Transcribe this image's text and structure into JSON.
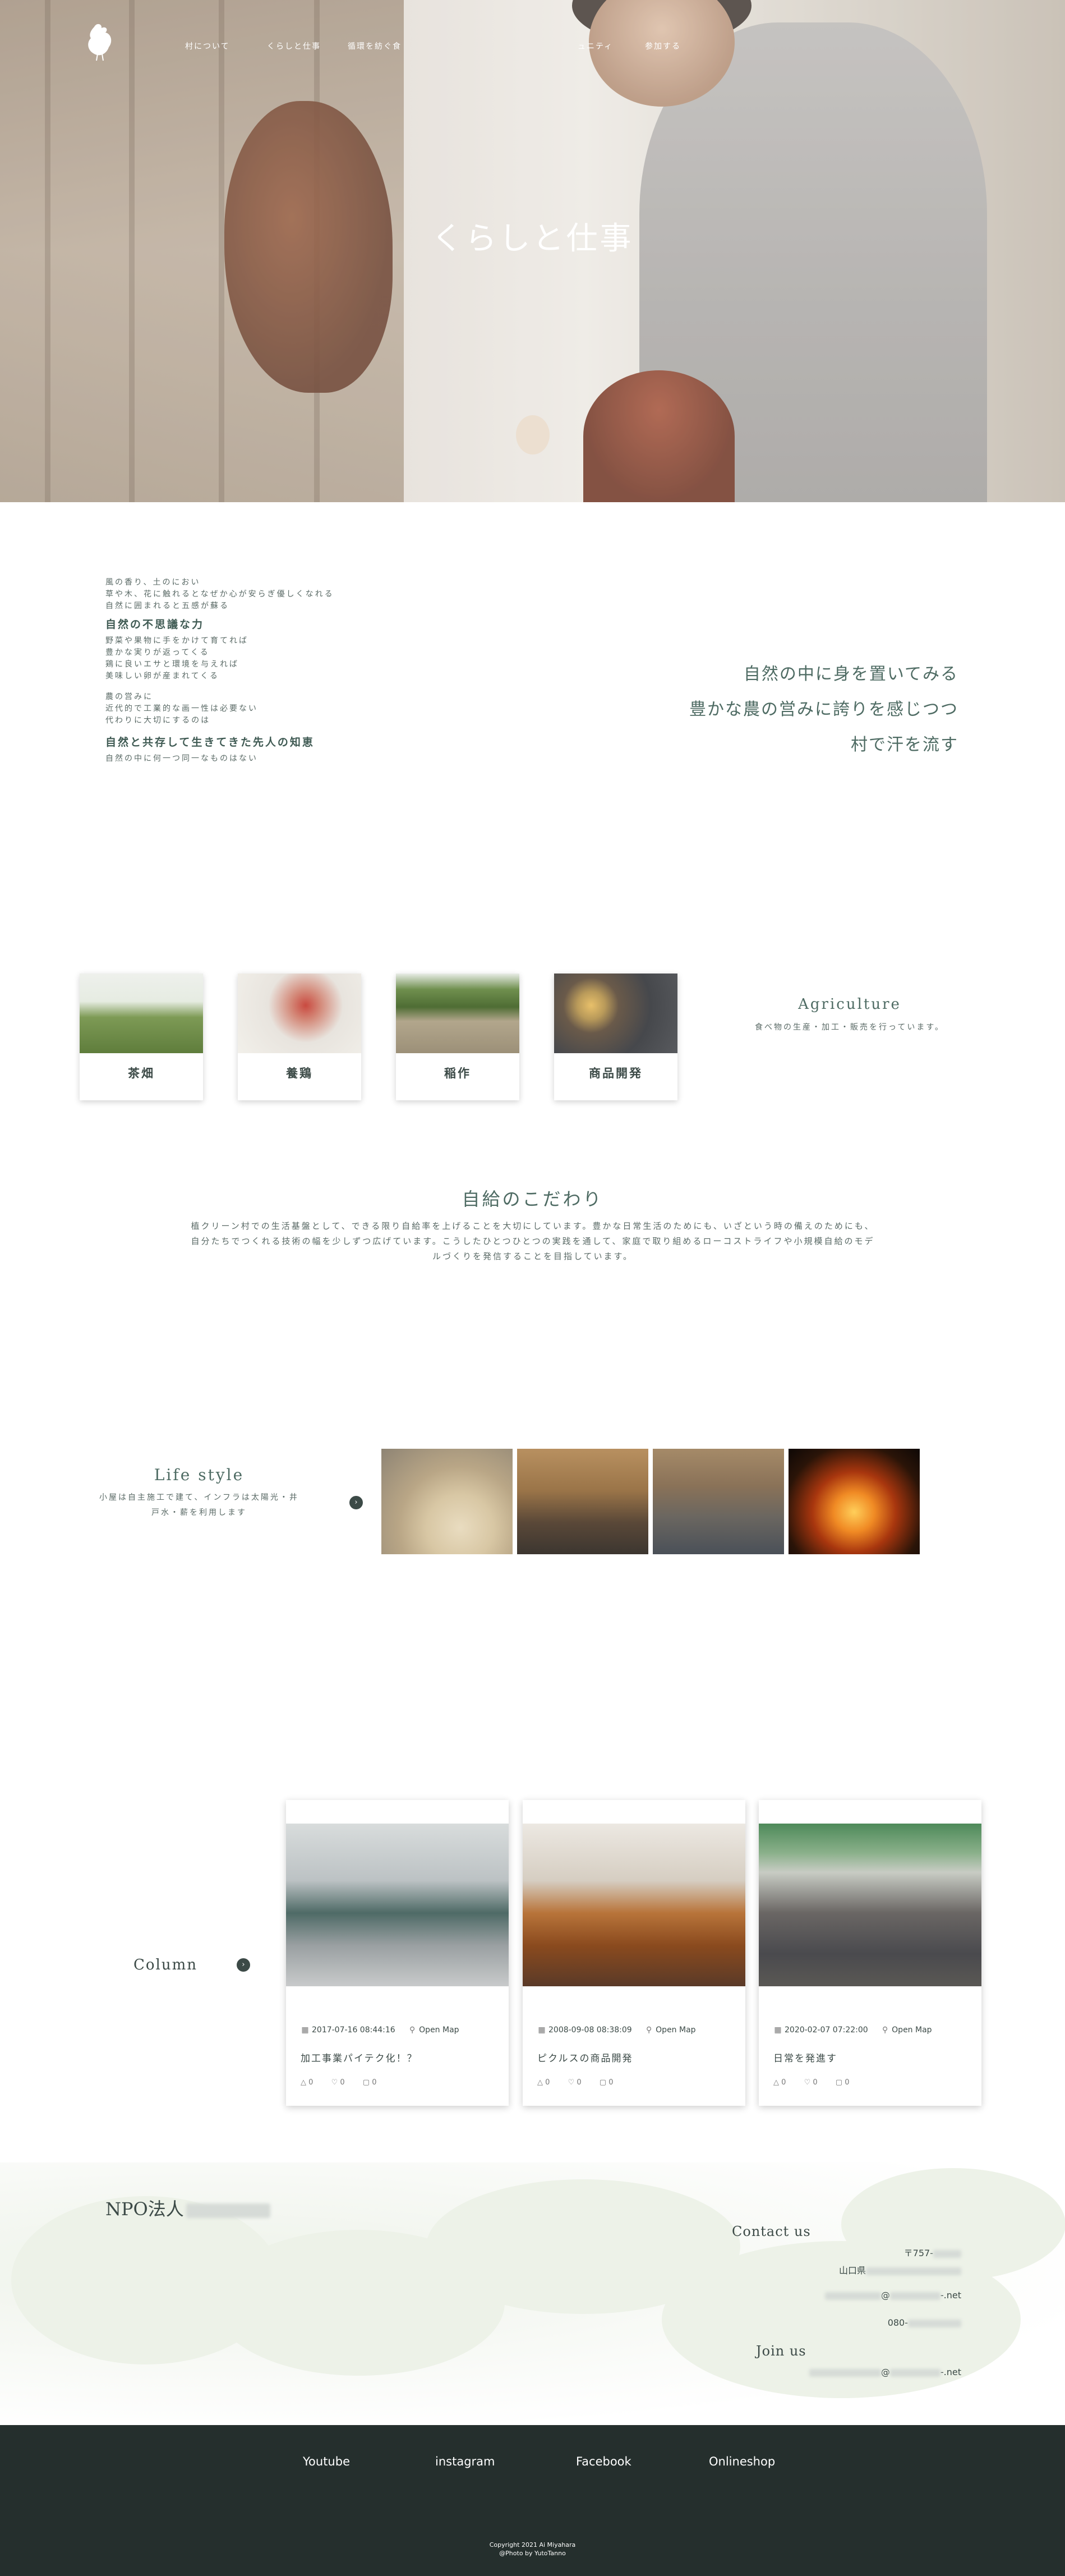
{
  "nav": {
    "items": [
      {
        "label": "村について"
      },
      {
        "label": "くらしと仕事"
      },
      {
        "label": "循環を紡ぐ食"
      },
      {
        "label": "ュニティ"
      },
      {
        "label": "参加する"
      }
    ]
  },
  "hero": {
    "title": "くらしと仕事"
  },
  "intro": {
    "para1": [
      "風の香り、土のにおい",
      "草や木、花に触れるとなぜか心が安らぎ優しくなれる",
      "自然に囲まれると五感が蘇る"
    ],
    "heading1": "自然の不思議な力",
    "para2": [
      "野菜や果物に手をかけて育てれば",
      "豊かな実りが返ってくる",
      "鶏に良いエサと環境を与えれば",
      "美味しい卵が産まれてくる"
    ],
    "para3": [
      "農の営みに",
      "近代的で工業的な画一性は必要ない",
      "代わりに大切にするのは"
    ],
    "heading2": "自然と共存して生きてきた先人の知恵",
    "para4": [
      "自然の中に何一つ同一なものはない"
    ],
    "right_lines": [
      "自然の中に身を置いてみる",
      "豊かな農の営みに誇りを感じつつ",
      "村で汗を流す"
    ]
  },
  "agriculture": {
    "cards": [
      {
        "label": "茶畑"
      },
      {
        "label": "養鶏"
      },
      {
        "label": "稲作"
      },
      {
        "label": "商品開発"
      }
    ],
    "title": "Agriculture",
    "subtitle": "食べ物の生産・加工・販売を行っています。"
  },
  "kodawari": {
    "title": "自給のこだわり",
    "body": [
      "植クリーン村での生活基盤として、できる限り自給率を上げることを大切にしています。豊かな日常生活のためにも、いざという時の備えのためにも、",
      "自分たちでつくれる技術の幅を少しずつ広げています。こうしたひとつひとつの実践を通して、家庭で取り組めるローコストライフや小規模自給のモデ",
      "ルづくりを発信することを目指しています。"
    ]
  },
  "lifestyle": {
    "title": "Life style",
    "body": [
      "小屋は自主施工で建て、インフラは太陽光・井",
      "戸水・薪を利用します"
    ],
    "arrow": "›"
  },
  "column": {
    "title": "Column",
    "arrow": "›",
    "map_label": "Open Map",
    "cards": [
      {
        "date": "2017-07-16 08:44:16",
        "title": "加工事業パイテク化！？",
        "likes": "0",
        "hearts": "0",
        "comments": "0"
      },
      {
        "date": "2008-09-08 08:38:09",
        "title": "ピクルスの商品開発",
        "likes": "0",
        "hearts": "0",
        "comments": "0"
      },
      {
        "date": "2020-02-07 07:22:00",
        "title": "日常を発進す",
        "likes": "0",
        "hearts": "0",
        "comments": "0"
      }
    ]
  },
  "contact": {
    "org": "NPO法人",
    "contact_head": "Contact us",
    "postal": "〒757-",
    "pref": "山口県",
    "email_domain": "@",
    "email_tld": "-.net",
    "phone": "080-",
    "join_head": "Join us",
    "join_email_at": "@",
    "join_email_tld": "-.net"
  },
  "footer": {
    "links": [
      "Youtube",
      "instagram",
      "Facebook",
      "Onlineshop"
    ],
    "copyright": "Copyright 2021 Ai Miyahara",
    "photo": "@Photo by YutoTanno"
  },
  "colors": {
    "accent": "#4e6b63",
    "footer_bg": "#252f2d"
  }
}
